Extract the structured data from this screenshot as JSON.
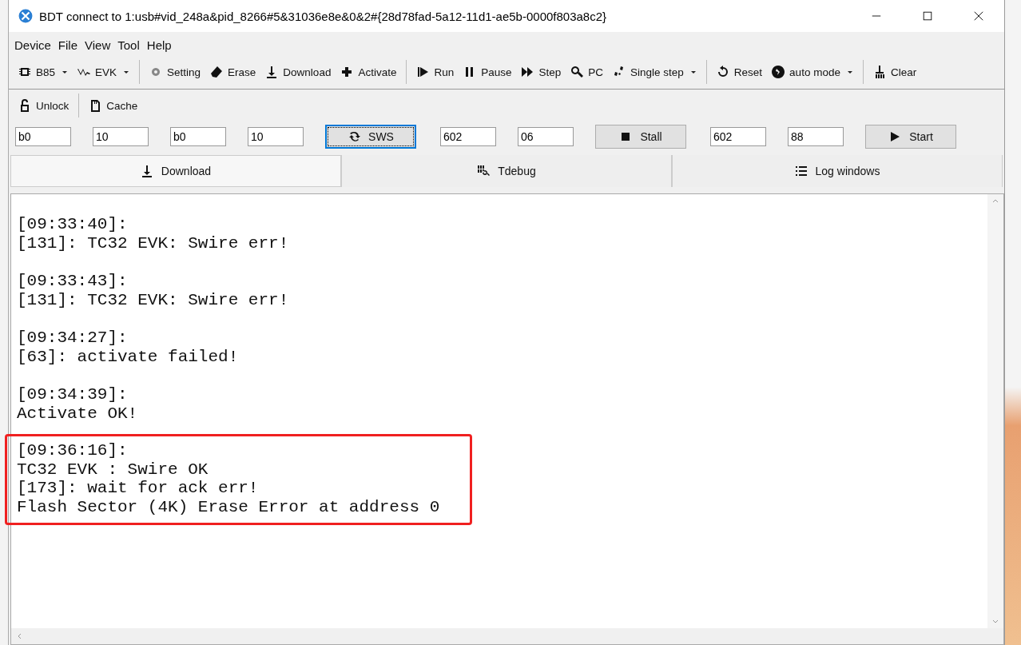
{
  "window": {
    "title": "BDT connect to 1:usb#vid_248a&pid_8266#5&31036e8e&0&2#{28d78fad-5a12-11d1-ae5b-0000f803a8c2}"
  },
  "menu": [
    "Device",
    "File",
    "View",
    "Tool",
    "Help"
  ],
  "toolbar": [
    {
      "kind": "button",
      "label": "B85",
      "dropdown": true
    },
    {
      "kind": "button",
      "label": "EVK",
      "dropdown": true
    },
    {
      "kind": "separator"
    },
    {
      "kind": "button",
      "label": "Setting",
      "dropdown": false
    },
    {
      "kind": "button",
      "label": "Erase",
      "dropdown": false
    },
    {
      "kind": "button",
      "label": "Download",
      "dropdown": false
    },
    {
      "kind": "button",
      "label": "Activate",
      "dropdown": false
    },
    {
      "kind": "separator"
    },
    {
      "kind": "button",
      "label": "Run",
      "dropdown": false
    },
    {
      "kind": "button",
      "label": "Pause",
      "dropdown": false
    },
    {
      "kind": "button",
      "label": "Step",
      "dropdown": false
    },
    {
      "kind": "button",
      "label": "PC",
      "dropdown": false
    },
    {
      "kind": "button",
      "label": "Single step",
      "dropdown": true
    },
    {
      "kind": "separator"
    },
    {
      "kind": "button",
      "label": "Reset",
      "dropdown": false
    },
    {
      "kind": "button",
      "label": "auto mode",
      "dropdown": true
    },
    {
      "kind": "separator"
    },
    {
      "kind": "button",
      "label": "Clear",
      "dropdown": false
    }
  ],
  "toolbar2": [
    {
      "kind": "button",
      "label": "Unlock"
    },
    {
      "kind": "separator"
    },
    {
      "kind": "button",
      "label": "Cache"
    }
  ],
  "controls": [
    {
      "kind": "field",
      "value": "b0"
    },
    {
      "kind": "field",
      "value": "10"
    },
    {
      "kind": "field",
      "value": "b0"
    },
    {
      "kind": "field",
      "value": "10"
    },
    {
      "kind": "button",
      "label": "SWS",
      "focused": true
    },
    {
      "kind": "field",
      "value": "602"
    },
    {
      "kind": "field",
      "value": "06"
    },
    {
      "kind": "button",
      "label": "Stall",
      "focused": false
    },
    {
      "kind": "field",
      "value": "602"
    },
    {
      "kind": "field",
      "value": "88"
    },
    {
      "kind": "button",
      "label": "Start",
      "focused": false
    }
  ],
  "tabs": [
    {
      "label": "Download",
      "selected": true
    },
    {
      "label": "Tdebug",
      "selected": false
    },
    {
      "label": "Log windows",
      "selected": false
    }
  ],
  "log": [
    {
      "highlighted": false,
      "lines": [
        "[09:33:40]:",
        "[131]: TC32 EVK: Swire err!"
      ]
    },
    {
      "highlighted": false,
      "lines": [
        "[09:33:43]:",
        "[131]: TC32 EVK: Swire err!"
      ]
    },
    {
      "highlighted": false,
      "lines": [
        "[09:34:27]:",
        "[63]: activate failed!"
      ]
    },
    {
      "highlighted": false,
      "lines": [
        "[09:34:39]:",
        "Activate OK!"
      ]
    },
    {
      "highlighted": true,
      "lines": [
        "[09:36:16]:",
        "TC32 EVK : Swire OK",
        "[173]: wait for ack err!",
        "Flash Sector (4K) Erase Error at address 0"
      ]
    }
  ]
}
